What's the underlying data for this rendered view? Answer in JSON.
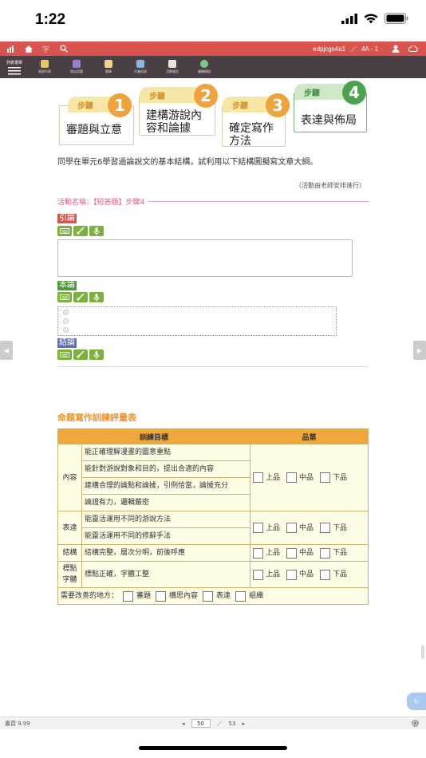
{
  "status_bar": {
    "time": "1:22"
  },
  "topbar": {
    "user": "edpjcgs4a1",
    "separator": "／",
    "class": "4A - 1"
  },
  "toolbar": {
    "menu_label": "列表選單",
    "tools": [
      "資源列表",
      "相似試題",
      "題庫",
      "作業紀錄",
      "活動報告",
      "擴轉模組"
    ]
  },
  "steps": [
    {
      "tab": "步驟",
      "num": "1",
      "text": "審題與立意"
    },
    {
      "tab": "步驟",
      "num": "2",
      "text_line1": "建構游說內",
      "text_line2": "容和論據"
    },
    {
      "tab": "步驟",
      "num": "3",
      "text_line1": "確定寫作",
      "text_line2": "方法"
    },
    {
      "tab": "步驟",
      "num": "4",
      "text": "表達與佈局"
    }
  ],
  "intro": "同學在單元6學習過論說文的基本結構，試利用以下結構圖擬寫文章大綱。",
  "note": "（活動由老師安排進行）",
  "activity": "活動名稱：【短答題】步驟4",
  "sections": {
    "intro_label": "引論",
    "body_label": "本論",
    "conclusion_label": "結論"
  },
  "colors": {
    "intro": "#d6564a",
    "body": "#4f9a3e",
    "conclusion": "#5e6fb5",
    "accent": "#f0a83a",
    "brand_red": "#d9534f"
  },
  "rubric": {
    "title": "命題寫作訓練評量表",
    "header_goal": "訓練目標",
    "header_grade": "品第",
    "grade_labels": [
      "上品",
      "中品",
      "下品"
    ],
    "content_cat": "內容",
    "content_items": [
      "能正確理解漫畫的圖意重點",
      "能針對游說對象和目的，提出合適的內容",
      "建構合理的論點和論據，引例恰當，論據充分",
      "論證有力，邏輯嚴密"
    ],
    "expression_cat": "表達",
    "expression_items": [
      "能靈活運用不同的游說方法",
      "能靈活運用不同的修辭手法"
    ],
    "structure_cat": "結構",
    "structure_item": "結構完整，層次分明，前後呼應",
    "punct_cat_line1": "標點",
    "punct_cat_line2": "字體",
    "punct_item": "標點正確，字體工整",
    "improve_label": "需要改善的地方：",
    "improve_options": [
      "審題",
      "構思內容",
      "表達",
      "組織"
    ]
  },
  "bottom": {
    "page_info": "書頁 9.99",
    "current_page": "50",
    "separator": "／",
    "total_pages": "53"
  }
}
